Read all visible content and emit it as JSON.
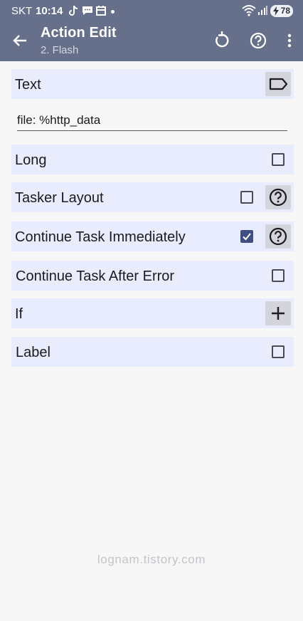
{
  "status_bar": {
    "carrier": "SKT",
    "time": "10:14",
    "battery": "78",
    "notification_icons": [
      "tiktok-icon",
      "chat-bubble-icon",
      "calendar-icon"
    ],
    "system_icons": [
      "wifi-icon",
      "signal-icon",
      "battery-charging-icon"
    ]
  },
  "app_bar": {
    "title": "Action Edit",
    "subtitle": "2. Flash",
    "icons": [
      "back-arrow-icon",
      "reset-icon",
      "help-icon",
      "more-vert-icon"
    ]
  },
  "fields": {
    "text": {
      "label": "Text",
      "value": "file: %http_data",
      "icon": "label-tag-icon"
    },
    "long": {
      "label": "Long",
      "checked": false
    },
    "tasker_layout": {
      "label": "Tasker Layout",
      "checked": false,
      "icon": "help-icon"
    },
    "continue_immediately": {
      "label": "Continue Task Immediately",
      "checked": true,
      "icon": "help-icon"
    },
    "continue_after_error": {
      "label": "Continue Task After Error",
      "checked": false
    },
    "if": {
      "label": "If",
      "icon": "plus-icon"
    },
    "label": {
      "label": "Label",
      "checked": false
    }
  },
  "watermark": "lognam.tistory.com",
  "colors": {
    "app_bar": "#66708a",
    "row_bg": "#e9ecfc",
    "checkbox_checked": "#3f4e80",
    "icon_button_bg": "#d4d5dc",
    "background": "#f7f7f8"
  }
}
